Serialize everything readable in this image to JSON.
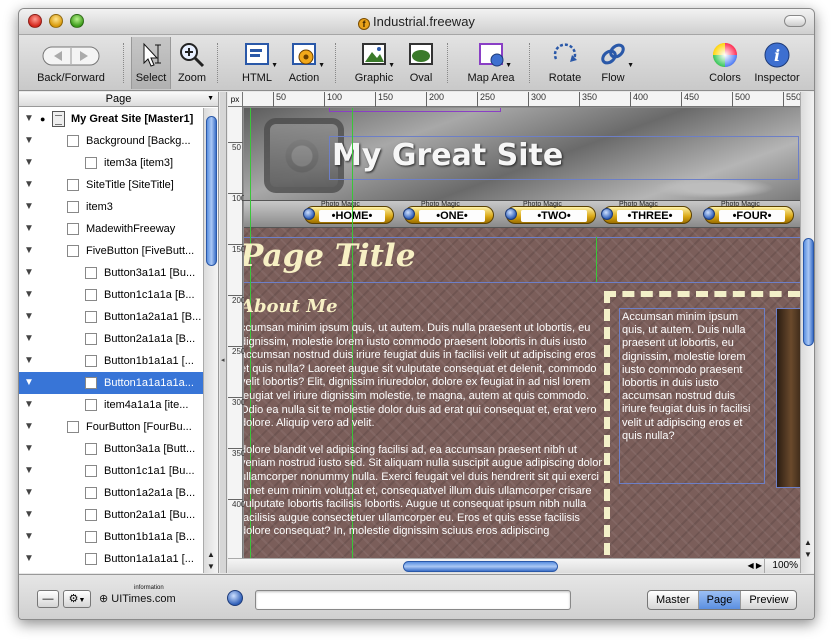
{
  "window": {
    "title": "Industrial.freeway"
  },
  "toolbar": {
    "back_forward": "Back/Forward",
    "select": "Select",
    "zoom": "Zoom",
    "html": "HTML",
    "action": "Action",
    "graphic": "Graphic",
    "oval": "Oval",
    "map_area": "Map Area",
    "rotate": "Rotate",
    "flow": "Flow",
    "colors": "Colors",
    "inspector": "Inspector"
  },
  "sidebar": {
    "header": "Page",
    "items": [
      {
        "label": "My Great Site [Master1]"
      },
      {
        "label": "Background [Backg..."
      },
      {
        "label": "item3a [item3]"
      },
      {
        "label": "SiteTitle [SiteTitle]"
      },
      {
        "label": "item3"
      },
      {
        "label": "MadewithFreeway"
      },
      {
        "label": "FiveButton [FiveButt..."
      },
      {
        "label": "Button3a1a1 [Bu..."
      },
      {
        "label": "Button1c1a1a [B..."
      },
      {
        "label": "Button1a2a1a1 [B..."
      },
      {
        "label": "Button2a1a1a [B..."
      },
      {
        "label": "Button1b1a1a1 [..."
      },
      {
        "label": "Button1a1a1a1a..."
      },
      {
        "label": "item4a1a1a [ite..."
      },
      {
        "label": "FourButton [FourBu..."
      },
      {
        "label": "Button3a1a [Butt..."
      },
      {
        "label": "Button1c1a1 [Bu..."
      },
      {
        "label": "Button1a2a1a [B..."
      },
      {
        "label": "Button2a1a1 [Bu..."
      },
      {
        "label": "Button1b1a1a [B..."
      },
      {
        "label": "Button1a1a1a1 [..."
      }
    ]
  },
  "rulers": {
    "unit": "px",
    "top": [
      "50",
      "100",
      "150",
      "200",
      "250",
      "300",
      "350",
      "400",
      "450",
      "500",
      "550"
    ],
    "left": [
      "50",
      "100",
      "150",
      "200",
      "250",
      "300",
      "350",
      "400"
    ]
  },
  "page": {
    "site_title": "My Great Site",
    "nav": [
      {
        "label": "•HOME•",
        "tag": "Photo Magic"
      },
      {
        "label": "•ONE•",
        "tag": "Photo Magic"
      },
      {
        "label": "•TWO•",
        "tag": "Photo Magic"
      },
      {
        "label": "•THREE•",
        "tag": "Photo Magic"
      },
      {
        "label": "•FOUR•",
        "tag": "Photo Magic"
      }
    ],
    "page_title": "Page Title",
    "about_heading": "About Me",
    "paragraph1": "ccumsan minim ipsum quis, ut autem. Duis nulla praesent ut lobortis, eu dignissim, molestie lorem iusto commodo praesent lobortis in duis iusto accumsan nostrud duis iriure feugiat duis in facilisi velit ut adipiscing eros et quis nulla? Laoreet augue sit vulputate consequat et delenit, commodo velit lobortis? Elit, dignissim iriuredolor, dolore ex feugiat in ad nisl lorem feugiat vel iriure dignissim molestie, te magna, autem at quis commodo. Odio ea nulla sit te molestie dolor duis ad erat qui consequat et, erat vero dolore. Aliquip vero ad velit.",
    "paragraph2": "dolore blandit vel adipiscing facilisi ad, ea accumsan praesent nibh ut veniam nostrud iusto sed. Sit aliquam nulla suscipit augue adipiscing dolor ullamcorper nonummy nulla. Exerci feugait vel duis hendrerit sit qui exerci amet eum minim volutpat et, consequatvel illum duis ullamcorper crisare vulputate lobortis facilisis lobortis. Augue ut consequat ipsum nibh nulla facilisis augue consectetuer ullamcorper eu. Eros et quis esse facilisis dolore consequat? In, molestie dignissim sciuus eros adipiscing",
    "sidebox_text": "Accumsan minim ipsum quis, ut autem. Duis nulla praesent ut lobortis, eu dignissim, molestie lorem iusto commodo praesent lobortis in duis iusto accumsan nostrud duis iriure feugiat duis in facilisi velit ut adipiscing eros et quis nulla?"
  },
  "scroll": {
    "zoom": "100%"
  },
  "bottombar": {
    "brand": "UITimes.com",
    "brand_sup": "information",
    "views": [
      "Master",
      "Page",
      "Preview"
    ],
    "active_view": "Page"
  },
  "colors": {
    "selection": "#3875d7",
    "guide": "#39c639",
    "page_bg": "#7b5e5a",
    "title_text": "#f7f0c4"
  }
}
